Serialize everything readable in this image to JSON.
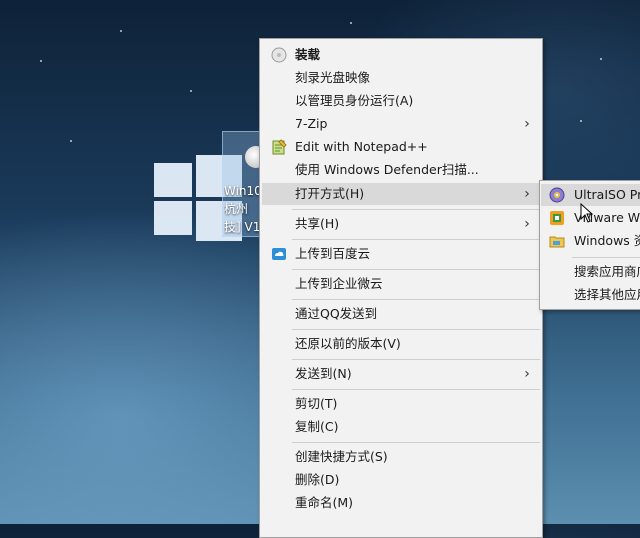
{
  "desktop": {
    "file_label": "Win10\n杭州\n技] V1"
  },
  "context_menu": {
    "items": [
      {
        "label": "装载",
        "icon": "disc-icon",
        "bold": true
      },
      {
        "label": "刻录光盘映像"
      },
      {
        "label": "以管理员身份运行(A)"
      },
      {
        "label": "7-Zip",
        "submenu": true
      },
      {
        "label": "Edit with Notepad++",
        "icon": "notepad-icon"
      },
      {
        "label": "使用 Windows Defender扫描..."
      },
      {
        "label": "打开方式(H)",
        "submenu": true
      },
      {
        "label": "共享(H)",
        "submenu": true
      },
      {
        "label": "上传到百度云",
        "icon": "cloud-icon"
      },
      {
        "label": "上传到企业微云"
      },
      {
        "label": "通过QQ发送到"
      },
      {
        "label": "还原以前的版本(V)"
      },
      {
        "label": "发送到(N)",
        "submenu": true
      },
      {
        "label": "剪切(T)"
      },
      {
        "label": "复制(C)"
      },
      {
        "label": "创建快捷方式(S)"
      },
      {
        "label": "删除(D)"
      },
      {
        "label": "重命名(M)"
      }
    ]
  },
  "open_with_submenu": {
    "items": [
      {
        "label": "UltraISO Pre",
        "icon": "ultraiso-icon"
      },
      {
        "label": "VMware Wo",
        "icon": "vmware-icon"
      },
      {
        "label": "Windows 资",
        "icon": "folder-icon"
      },
      {
        "label": "搜索应用商店"
      },
      {
        "label": "选择其他应用"
      }
    ]
  },
  "colors": {
    "menu_bg": "#f2f2f2",
    "hover_bg": "#d9d9d9",
    "separator": "#cfcfcf"
  }
}
